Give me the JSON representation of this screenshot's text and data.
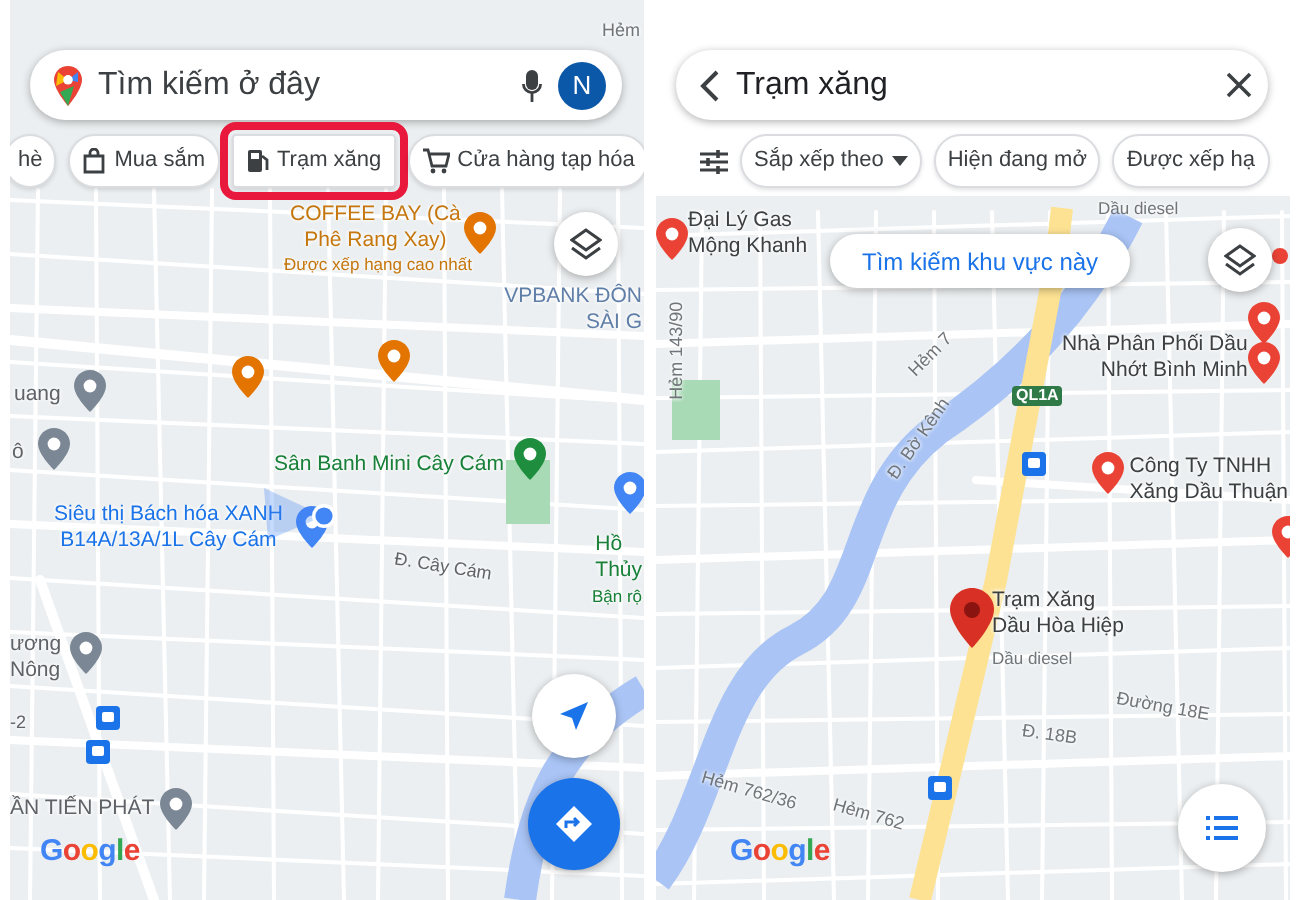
{
  "screens": [
    {
      "kind": "explore",
      "search": {
        "placeholder": "Tìm kiếm ở đây",
        "avatar": "N"
      },
      "chips": [
        {
          "label": "hè",
          "kind": "none",
          "selected": false
        },
        {
          "label": "Mua sắm",
          "kind": "bag",
          "selected": false
        },
        {
          "label": "Trạm xăng",
          "kind": "fuel",
          "selected": true
        },
        {
          "label": "Cửa hàng tạp hóa",
          "kind": "cart",
          "selected": false
        }
      ],
      "labels": [
        {
          "kind": "street",
          "lines": [
            "Hẻm"
          ],
          "color": "#70757a"
        },
        {
          "kind": "place",
          "lines": [
            "COFFEE BAY (Cà",
            "Phê Rang Xay)"
          ],
          "color": "#c5770e"
        },
        {
          "kind": "note",
          "lines": [
            "Được xếp hạng cao nhất"
          ],
          "color": "#c5770e"
        },
        {
          "kind": "place",
          "lines": [
            "VPBANK ĐÔN",
            "SÀI G"
          ],
          "color": "#5f7ea8"
        },
        {
          "kind": "place",
          "lines": [
            "uang"
          ],
          "color": "#5f6368"
        },
        {
          "kind": "place",
          "lines": [
            "ô"
          ],
          "color": "#5f6368"
        },
        {
          "kind": "place",
          "lines": [
            "Sân Banh Mini Cây Cám"
          ],
          "color": "#188038"
        },
        {
          "kind": "place",
          "lines": [
            "Siêu thị Bách hóa XANH",
            "B14A/13A/1L Cây Cám"
          ],
          "color": "#1a73e8"
        },
        {
          "kind": "street",
          "lines": [
            "Đ. Cây Cám"
          ],
          "color": "#5f6368"
        },
        {
          "kind": "place",
          "lines": [
            "Hồ",
            "Thủy"
          ],
          "color": "#188038"
        },
        {
          "kind": "note",
          "lines": [
            "Bận rộ"
          ],
          "color": "#188038"
        },
        {
          "kind": "place",
          "lines": [
            "ương",
            "Nông"
          ],
          "color": "#5f6368"
        },
        {
          "kind": "street",
          "lines": [
            "-2"
          ],
          "color": "#5f6368"
        },
        {
          "kind": "place",
          "lines": [
            "ẦN TIẾN PHÁT"
          ],
          "color": "#5f6368"
        }
      ],
      "pins": [
        {
          "kind": "pin",
          "color": "#e37400"
        },
        {
          "kind": "pin",
          "color": "#e37400"
        },
        {
          "kind": "pin",
          "color": "#e37400"
        },
        {
          "kind": "pin",
          "color": "#7b8794"
        },
        {
          "kind": "pin",
          "color": "#7b8794"
        },
        {
          "kind": "pin",
          "color": "#1e8e3e"
        },
        {
          "kind": "pin",
          "color": "#4285f4"
        },
        {
          "kind": "pin",
          "color": "#4285f4"
        },
        {
          "kind": "pin",
          "color": "#7b8794"
        },
        {
          "kind": "bus",
          "color": "#1a73e8"
        },
        {
          "kind": "bus",
          "color": "#1a73e8"
        },
        {
          "kind": "pin",
          "color": "#7b8794"
        }
      ],
      "my_location": true,
      "logo": "Google",
      "fab": {
        "kind": "directions"
      }
    },
    {
      "kind": "results",
      "search": {
        "value": "Trạm xăng"
      },
      "chips": [
        {
          "label": "Sắp xếp theo",
          "kind": "dropdown",
          "selected": false
        },
        {
          "label": "Hiện đang mở",
          "kind": "none",
          "selected": false
        },
        {
          "label": "Được xếp hạ",
          "kind": "none",
          "selected": false
        }
      ],
      "search_area_button": "Tìm kiếm khu vực này",
      "labels": [
        {
          "kind": "note",
          "lines": [
            "Dầu diesel"
          ],
          "color": "#70757a"
        },
        {
          "kind": "place",
          "lines": [
            "Đại Lý Gas",
            "Mộng Khanh"
          ],
          "color": "#3c4043"
        },
        {
          "kind": "street",
          "lines": [
            "Hẻm 143/90"
          ],
          "color": "#70757a"
        },
        {
          "kind": "street",
          "lines": [
            "Hẻm 7"
          ],
          "color": "#70757a"
        },
        {
          "kind": "place",
          "lines": [
            "Nhà Phân Phối Dầu",
            "Nhớt Bình Minh"
          ],
          "color": "#3c4043"
        },
        {
          "kind": "street",
          "lines": [
            "Đ. Bờ Kênh"
          ],
          "color": "#70757a"
        },
        {
          "kind": "shield",
          "lines": [
            "QL1A"
          ],
          "color": "#3a7d44"
        },
        {
          "kind": "place",
          "lines": [
            "Công Ty TNHH",
            "Xăng Dầu Thuận"
          ],
          "color": "#3c4043"
        },
        {
          "kind": "place",
          "lines": [
            "Trạm Xăng",
            "Dầu Hòa Hiệp"
          ],
          "color": "#3c4043"
        },
        {
          "kind": "note",
          "lines": [
            "Dầu diesel"
          ],
          "color": "#70757a"
        },
        {
          "kind": "street",
          "lines": [
            "Đường 18E"
          ],
          "color": "#70757a"
        },
        {
          "kind": "street",
          "lines": [
            "Đ. 18B"
          ],
          "color": "#70757a"
        },
        {
          "kind": "street",
          "lines": [
            "Hẻm 762/36"
          ],
          "color": "#70757a"
        },
        {
          "kind": "street",
          "lines": [
            "Hẻm 762"
          ],
          "color": "#70757a"
        }
      ],
      "pins": [
        {
          "kind": "pin",
          "color": "#ea4335"
        },
        {
          "kind": "pin",
          "color": "#ea4335"
        },
        {
          "kind": "pin",
          "color": "#ea4335"
        },
        {
          "kind": "pin",
          "color": "#ea4335"
        },
        {
          "kind": "pin",
          "color": "#ea4335"
        },
        {
          "kind": "pin-large",
          "color": "#d93025"
        },
        {
          "kind": "bus",
          "color": "#1a73e8"
        },
        {
          "kind": "bus",
          "color": "#1a73e8"
        },
        {
          "kind": "dot",
          "color": "#ea4335"
        }
      ],
      "logo": "Google",
      "fab": {
        "kind": "list"
      }
    }
  ]
}
